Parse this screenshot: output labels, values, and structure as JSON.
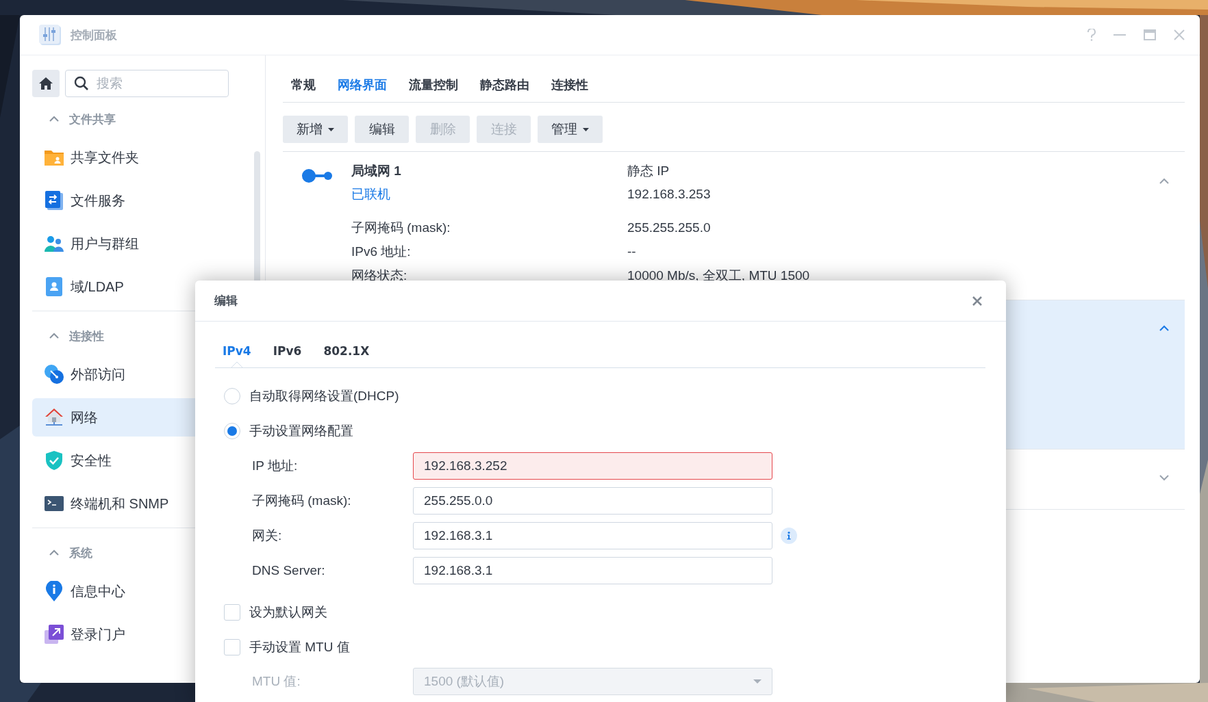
{
  "window": {
    "title": "控制面板"
  },
  "sidebar": {
    "search": {
      "placeholder": "搜索"
    },
    "sections": [
      {
        "title": "文件共享",
        "expanded": true,
        "items": [
          {
            "label": "共享文件夹",
            "selected": false
          },
          {
            "label": "文件服务",
            "selected": false
          },
          {
            "label": "用户与群组",
            "selected": false
          },
          {
            "label": "域/LDAP",
            "selected": false
          }
        ]
      },
      {
        "title": "连接性",
        "expanded": true,
        "items": [
          {
            "label": "外部访问",
            "selected": false
          },
          {
            "label": "网络",
            "selected": true
          },
          {
            "label": "安全性",
            "selected": false
          },
          {
            "label": "终端机和 SNMP",
            "selected": false
          }
        ]
      },
      {
        "title": "系统",
        "expanded": true,
        "items": [
          {
            "label": "信息中心",
            "selected": false
          },
          {
            "label": "登录门户",
            "selected": false
          }
        ]
      }
    ]
  },
  "tabs": [
    {
      "label": "常规",
      "selected": false
    },
    {
      "label": "网络界面",
      "selected": true
    },
    {
      "label": "流量控制",
      "selected": false
    },
    {
      "label": "静态路由",
      "selected": false
    },
    {
      "label": "连接性",
      "selected": false
    }
  ],
  "toolbar": [
    {
      "label": "新增",
      "dropdown": true,
      "disabled": false
    },
    {
      "label": "编辑",
      "dropdown": false,
      "disabled": false
    },
    {
      "label": "删除",
      "dropdown": false,
      "disabled": true
    },
    {
      "label": "连接",
      "dropdown": false,
      "disabled": true
    },
    {
      "label": "管理",
      "dropdown": true,
      "disabled": false
    }
  ],
  "interfaces": [
    {
      "name": "局域网 1",
      "status": "已联机",
      "mode": "静态 IP",
      "address": "192.168.3.253",
      "details": [
        {
          "label": "子网掩码 (mask):",
          "value": "255.255.255.0"
        },
        {
          "label": "IPv6 地址:",
          "value": "--"
        },
        {
          "label": "网络状态:",
          "value": "10000 Mb/s, 全双工, MTU 1500"
        }
      ],
      "selected": false,
      "expanded": true
    },
    {
      "selected": true,
      "expanded": true
    },
    {
      "selected": false,
      "expanded": false
    }
  ],
  "dialog": {
    "title": "编辑",
    "tabs": [
      {
        "label": "IPv4",
        "selected": true
      },
      {
        "label": "IPv6",
        "selected": false
      },
      {
        "label": "802.1X",
        "selected": false
      }
    ],
    "modes": [
      {
        "label": "自动取得网络设置(DHCP)",
        "selected": false
      },
      {
        "label": "手动设置网络配置",
        "selected": true
      }
    ],
    "fields": [
      {
        "label": "IP 地址:",
        "value": "192.168.3.252",
        "error": true,
        "info": false
      },
      {
        "label": "子网掩码 (mask):",
        "value": "255.255.0.0",
        "error": false,
        "info": false
      },
      {
        "label": "网关:",
        "value": "192.168.3.1",
        "error": false,
        "info": true
      },
      {
        "label": "DNS Server:",
        "value": "192.168.3.1",
        "error": false,
        "info": false
      }
    ],
    "options": [
      {
        "label": "设为默认网关",
        "checked": false
      },
      {
        "label": "手动设置 MTU 值",
        "checked": false
      }
    ],
    "mtu": {
      "label": "MTU 值:",
      "value": "1500 (默认值)",
      "disabled": true
    }
  }
}
